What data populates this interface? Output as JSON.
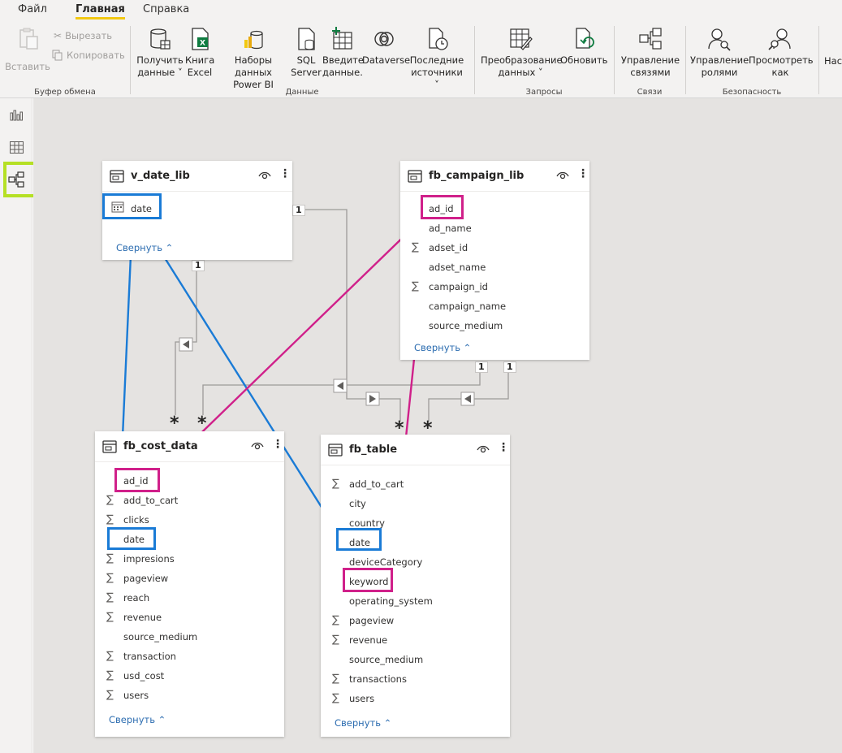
{
  "menu": {
    "file": "Файл",
    "home": "Главная",
    "help": "Справка"
  },
  "ribbon": {
    "clipboard": {
      "paste": "Вставить",
      "cut": "Вырезать",
      "copy": "Копировать",
      "label": "Буфер обмена"
    },
    "data": {
      "get_data": [
        "Получить",
        "данные"
      ],
      "excel": [
        "Книга",
        "Excel"
      ],
      "powerbi": [
        "Наборы данных",
        "Power BI"
      ],
      "sql": [
        "SQL",
        "Server"
      ],
      "enter": [
        "Введите",
        "данные."
      ],
      "dataverse": "Dataverse",
      "recent": [
        "Последние",
        "источники"
      ],
      "label": "Данные"
    },
    "queries": {
      "transform": [
        "Преобразование",
        "данных"
      ],
      "refresh": "Обновить",
      "label": "Запросы"
    },
    "relations": {
      "manage": [
        "Управление",
        "связями"
      ],
      "label": "Связи"
    },
    "security": {
      "roles": [
        "Управление",
        "ролями"
      ],
      "view_as": [
        "Просмотреть",
        "как"
      ],
      "label": "Безопасность"
    },
    "cut_off": "Нас"
  },
  "cards": {
    "v_date_lib": {
      "title": "v_date_lib",
      "fields": [
        "date"
      ],
      "collapse": "Свернуть"
    },
    "fb_campaign_lib": {
      "title": "fb_campaign_lib",
      "fields": [
        "ad_id",
        "ad_name",
        "adset_id",
        "adset_name",
        "campaign_id",
        "campaign_name",
        "source_medium"
      ],
      "collapse": "Свернуть"
    },
    "fb_cost_data": {
      "title": "fb_cost_data",
      "fields": [
        "ad_id",
        "add_to_cart",
        "clicks",
        "date",
        "impresions",
        "pageview",
        "reach",
        "revenue",
        "source_medium",
        "transaction",
        "usd_cost",
        "users"
      ],
      "collapse": "Свернуть"
    },
    "fb_table": {
      "title": "fb_table",
      "fields": [
        "add_to_cart",
        "city",
        "country",
        "date",
        "deviceCategory",
        "keyword",
        "operating_system",
        "pageview",
        "revenue",
        "source_medium",
        "transactions",
        "users"
      ],
      "collapse": "Свернуть"
    }
  },
  "relationship_labels": {
    "one": "1",
    "many": "*"
  },
  "colors": {
    "blue_highlight": "#1a7bd6",
    "pink_highlight": "#d0208a",
    "rail_selection": "#b5e025",
    "accent": "#f2c811"
  }
}
